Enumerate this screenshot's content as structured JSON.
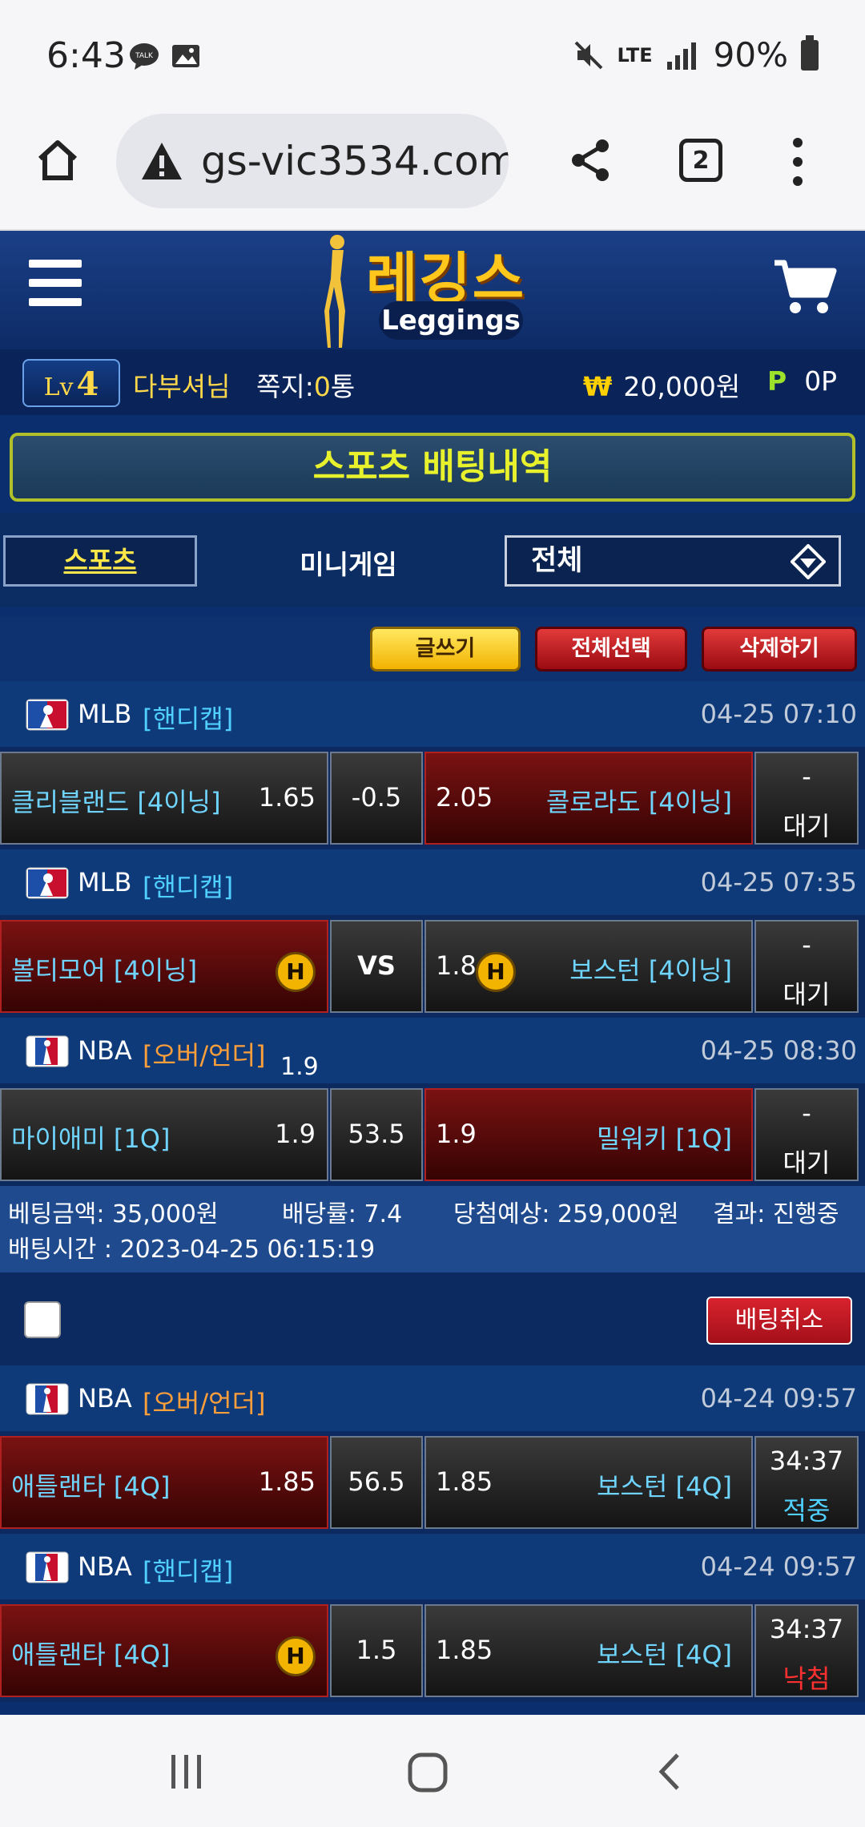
{
  "status_bar": {
    "time": "6:43",
    "signal_label": "LTE",
    "battery": "90%"
  },
  "browser": {
    "url": "gs-vic3534.com",
    "tab_count": "2"
  },
  "site": {
    "logo_kr": "레깅스",
    "logo_en": "Leggings"
  },
  "user": {
    "level_prefix": "Lv",
    "level": "4",
    "name": "다부셔님",
    "memo_label": "쪽지:",
    "memo_count": "0",
    "memo_unit": "통",
    "money": "20,000원",
    "point": "0P"
  },
  "page_title": "스포츠 배팅내역",
  "tabs": {
    "sports": "스포츠",
    "mini": "미니게임",
    "filter": "전체"
  },
  "actions": {
    "write": "글쓰기",
    "select_all": "전체선택",
    "delete": "삭제하기"
  },
  "slip1": {
    "games": [
      {
        "league": "MLB",
        "type": "[핸디캡]",
        "type_color": "blue",
        "datetime": "04-25 07:10",
        "home": "클리블랜드 [4이닝]",
        "home_odds": "1.65",
        "middle": "-0.5",
        "away_odds": "2.05",
        "away": "콜로라도 [4이닝]",
        "status_top": "-",
        "status_bot": "대기"
      },
      {
        "league": "MLB",
        "type": "[핸디캡]",
        "type_color": "blue",
        "datetime": "04-25 07:35",
        "home": "볼티모어 [4이닝]",
        "home_odds": "",
        "middle": "VS",
        "away_odds": "1.8",
        "away": "보스턴 [4이닝]",
        "status_top": "-",
        "status_bot": "대기"
      },
      {
        "league": "NBA",
        "type": "[오버/언더]",
        "type_color": "orange",
        "datetime": "04-25 08:30",
        "extra": "1.9",
        "home": "마이애미 [1Q]",
        "home_odds": "1.9",
        "middle": "53.5",
        "away_odds": "1.9",
        "away": "밀워키 [1Q]",
        "status_top": "-",
        "status_bot": "대기"
      }
    ],
    "summary": {
      "bet_amount": "베팅금액: 35,000원",
      "odds": "배당률: 7.4",
      "expected": "당첨예상: 259,000원",
      "result": "결과: 진행중",
      "bet_time": "배팅시간 : 2023-04-25 06:15:19"
    },
    "cancel_label": "배팅취소"
  },
  "slip2": {
    "games": [
      {
        "league": "NBA",
        "type": "[오버/언더]",
        "type_color": "orange",
        "datetime": "04-24 09:57",
        "home": "애틀랜타 [4Q]",
        "home_odds": "1.85",
        "middle": "56.5",
        "away_odds": "1.85",
        "away": "보스턴 [4Q]",
        "status_top": "34:37",
        "status_bot": "적중"
      },
      {
        "league": "NBA",
        "type": "[핸디캡]",
        "type_color": "blue",
        "datetime": "04-24 09:57",
        "home": "애틀랜타 [4Q]",
        "home_odds": "",
        "middle": "1.5",
        "away_odds": "1.85",
        "away": "보스턴 [4Q]",
        "status_top": "34:37",
        "status_bot": "낙첨"
      }
    ]
  },
  "badges": {
    "handicap": "H"
  },
  "colors": {
    "hit": "#4fd0ff",
    "miss": "#ff3030",
    "accent_yellow": "#ffd84a",
    "selected_red": "#7a1212"
  },
  "icons": [
    "talk-icon",
    "gallery-icon",
    "mute-icon",
    "signal-icon",
    "battery-icon",
    "home-icon",
    "warning-icon",
    "share-icon",
    "tabs-icon",
    "more-icon",
    "hamburger-icon",
    "cart-icon",
    "won-icon",
    "point-icon",
    "dropdown-icon",
    "mlb-logo-icon",
    "nba-logo-icon",
    "recent-apps-icon",
    "home-nav-icon",
    "back-icon"
  ]
}
